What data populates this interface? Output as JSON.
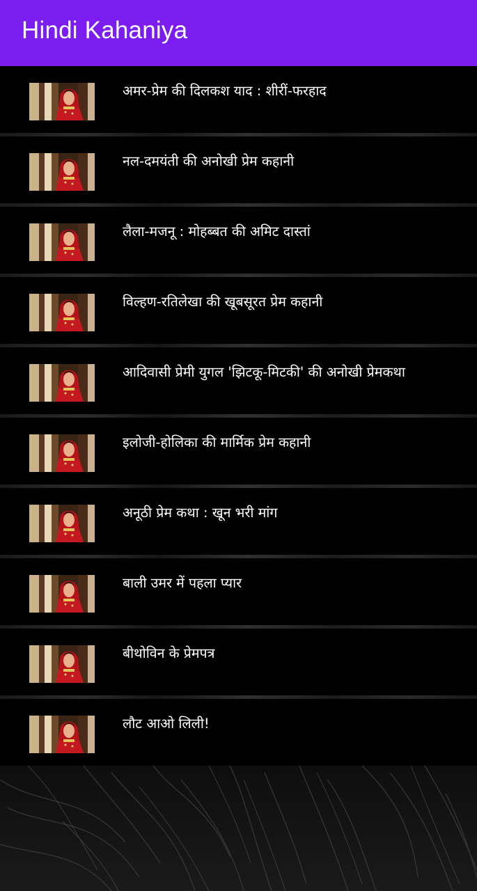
{
  "app_bar": {
    "title": "Hindi Kahaniya",
    "color": "#7b1cf0"
  },
  "stories": [
    {
      "title": "अमर-प्रेम की दिलकश याद : शीरीं-फरहाद",
      "thumbnail_icon": "woman-in-red-saree-thumbnail"
    },
    {
      "title": "नल-दमयंती की अनोखी प्रेम कहानी",
      "thumbnail_icon": "woman-in-red-saree-thumbnail"
    },
    {
      "title": "लैला-मजनू : मोहब्बत की अमिट दास्तां",
      "thumbnail_icon": "woman-in-red-saree-thumbnail"
    },
    {
      "title": "विल्हण-रतिलेखा की खूबसूरत प्रेम कहानी",
      "thumbnail_icon": "woman-in-red-saree-thumbnail"
    },
    {
      "title": "आदिवासी प्रेमी युगल 'झिटकू-मिटकी' की अनोखी प्रेमकथा",
      "thumbnail_icon": "woman-in-red-saree-thumbnail"
    },
    {
      "title": "इलोजी-होलिका की मार्मिक प्रेम कहानी",
      "thumbnail_icon": "woman-in-red-saree-thumbnail"
    },
    {
      "title": "अनूठी प्रेम कथा : खून भरी मांग",
      "thumbnail_icon": "woman-in-red-saree-thumbnail"
    },
    {
      "title": "बाली उमर में पहला प्यार",
      "thumbnail_icon": "woman-in-red-saree-thumbnail"
    },
    {
      "title": "बीथोविन के प्रेमपत्र",
      "thumbnail_icon": "woman-in-red-saree-thumbnail"
    },
    {
      "title": "लौट आओ लिली!",
      "thumbnail_icon": "woman-in-red-saree-thumbnail"
    }
  ]
}
